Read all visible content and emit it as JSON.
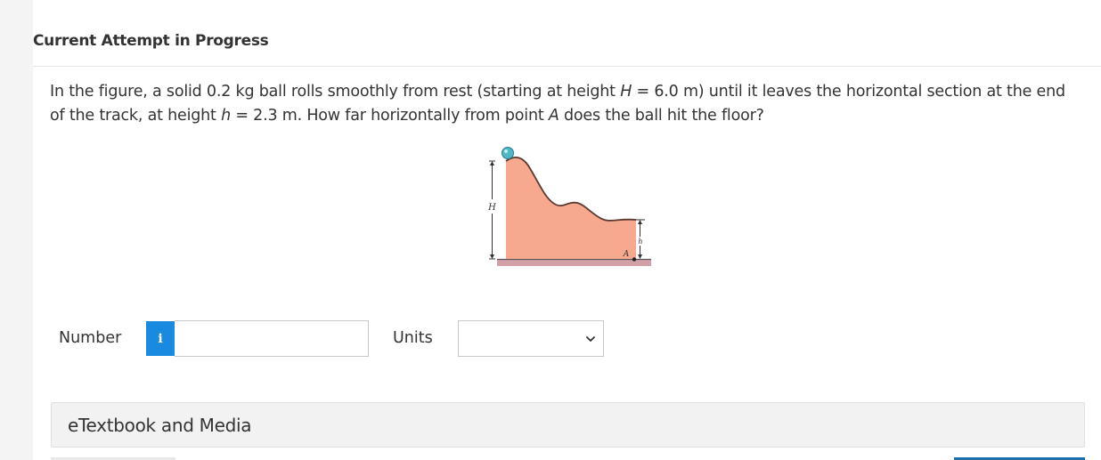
{
  "header": {
    "title": "Current Attempt in Progress"
  },
  "question": {
    "part1": "In the figure, a solid 0.2 kg ball rolls smoothly from rest (starting at height ",
    "var_H": "H",
    "part2": " = 6.0 m) until it leaves the horizontal section at the end of the track, at height ",
    "var_h": "h",
    "part3": " = 2.3 m. How far horizontally from point ",
    "var_A": "A",
    "part4": " does the ball hit the floor?"
  },
  "figure": {
    "label_H": "H",
    "label_h": "h",
    "label_A": "A",
    "colors": {
      "track_fill": "#f7a98f",
      "floor": "#d4a0a8",
      "ball": "#4fb8c8"
    }
  },
  "answer": {
    "number_label": "Number",
    "info_icon": "i",
    "number_value": "",
    "units_label": "Units",
    "units_selected": ""
  },
  "resources": {
    "etextbook_label": "eTextbook and Media"
  }
}
